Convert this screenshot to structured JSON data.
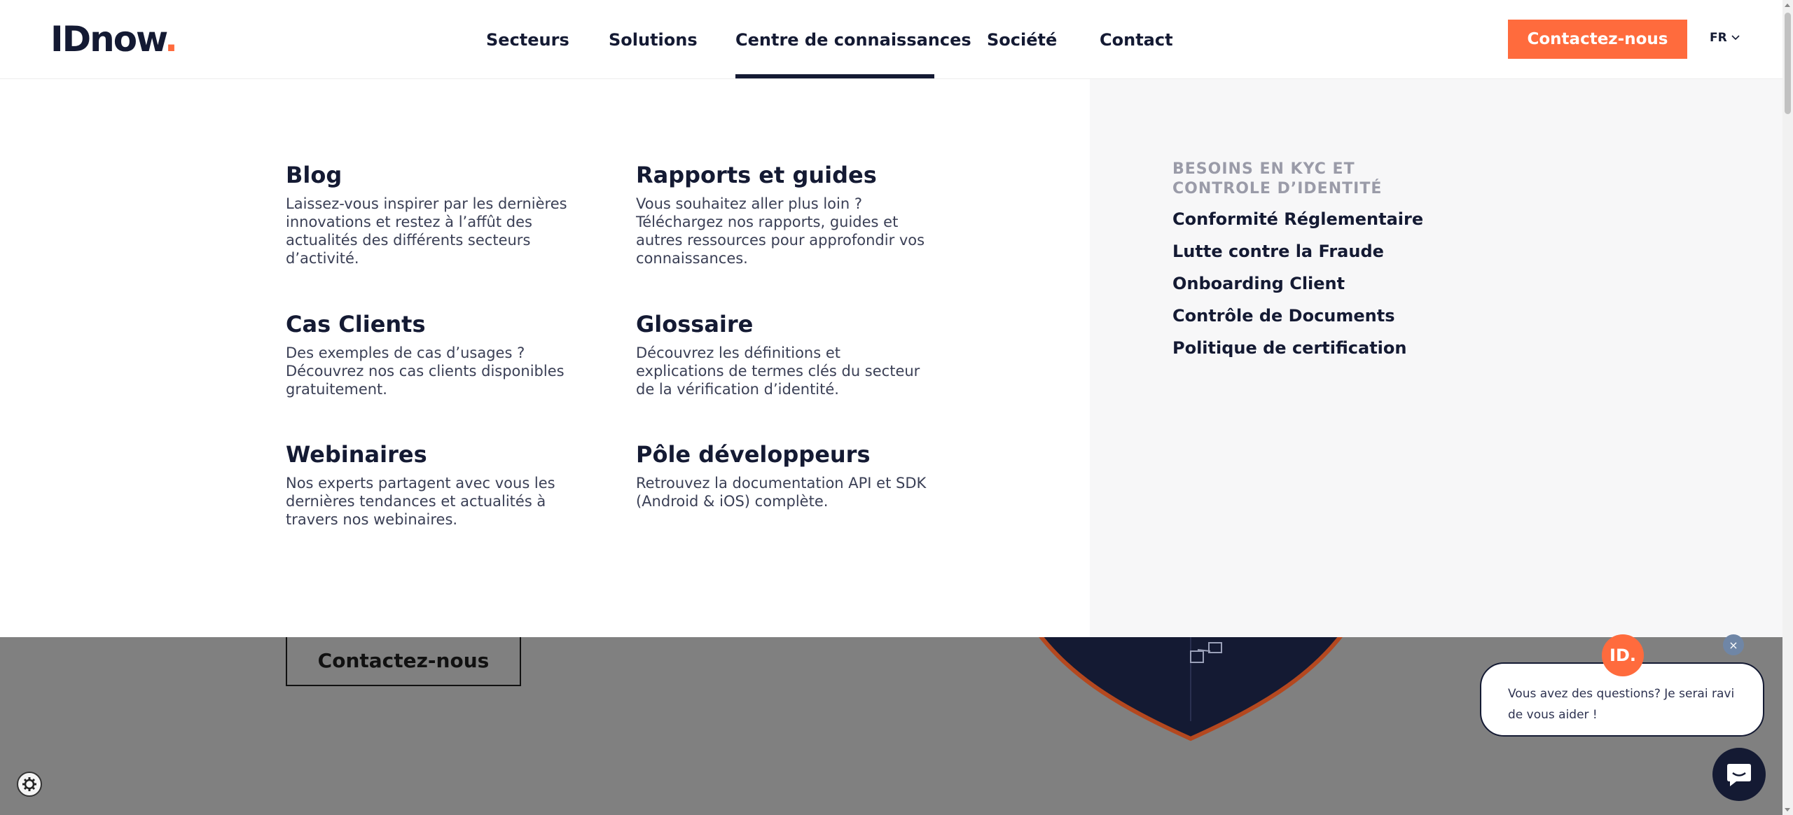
{
  "header": {
    "logo_text": "IDnow",
    "logo_dot": ".",
    "nav": [
      "Secteurs",
      "Solutions",
      "Centre de connaissances",
      "Société",
      "Contact"
    ],
    "active_nav": "Centre de connaissances",
    "cta_label": "Contactez-nous",
    "language": "FR"
  },
  "mega_menu": {
    "cards": [
      {
        "title": "Blog",
        "desc": "Laissez-vous inspirer par les dernières innovations et restez à l’affût des actualités des différents secteurs d’activité."
      },
      {
        "title": "Rapports et guides",
        "desc": "Vous souhaitez aller plus loin ? Téléchargez nos rapports, guides et autres ressources pour approfondir vos connaissances."
      },
      {
        "title": "Cas Clients",
        "desc": "Des exemples de cas d’usages ? Découvrez nos cas clients disponibles gratuitement."
      },
      {
        "title": "Glossaire",
        "desc": "Découvrez les définitions et explications de termes clés du secteur de la vérification d’identité."
      },
      {
        "title": "Webinaires",
        "desc": "Nos experts partagent avec vous les dernières tendances et actualités à travers nos webinaires."
      },
      {
        "title": "Pôle développeurs",
        "desc": "Retrouvez la documentation API et SDK (Android & iOS) complète."
      }
    ],
    "side": {
      "heading": "BESOINS EN KYC ET CONTROLE D’IDENTITÉ",
      "links": [
        "Conformité Réglementaire",
        "Lutte contre la Fraude",
        "Onboarding Client",
        "Contrôle de Documents",
        "Politique de certification"
      ]
    }
  },
  "page": {
    "cta_label": "Contactez-nous"
  },
  "chat": {
    "avatar_text": "ID.",
    "close_symbol": "×",
    "message": "Vous avez des questions? Je serai ravi de vous aider !"
  },
  "colors": {
    "brand_dark": "#141a33",
    "accent": "#ff6b3d",
    "overlay": "#808080"
  },
  "icons": [
    "chevron-down-icon",
    "cookie-settings-icon",
    "chat-icon",
    "close-icon"
  ]
}
